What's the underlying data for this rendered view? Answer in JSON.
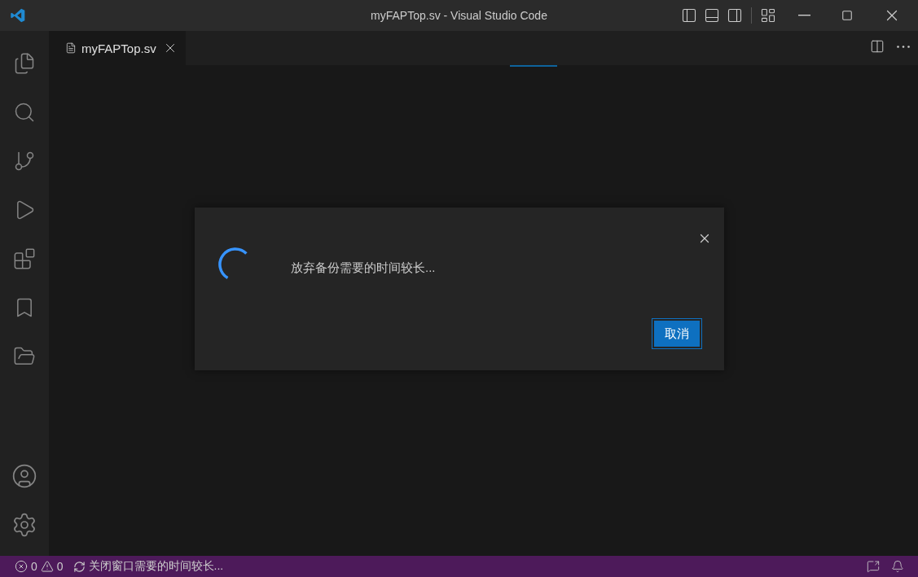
{
  "window": {
    "title": "myFAPTop.sv - Visual Studio Code"
  },
  "tabs": [
    {
      "label": "myFAPTop.sv",
      "selected": true
    }
  ],
  "dialog": {
    "message": "放弃备份需要的时间较长...",
    "buttons": [
      "取消"
    ]
  },
  "status_bar": {
    "errors": "0",
    "warnings": "0",
    "progress": "关闭窗口需要的时间较长..."
  }
}
